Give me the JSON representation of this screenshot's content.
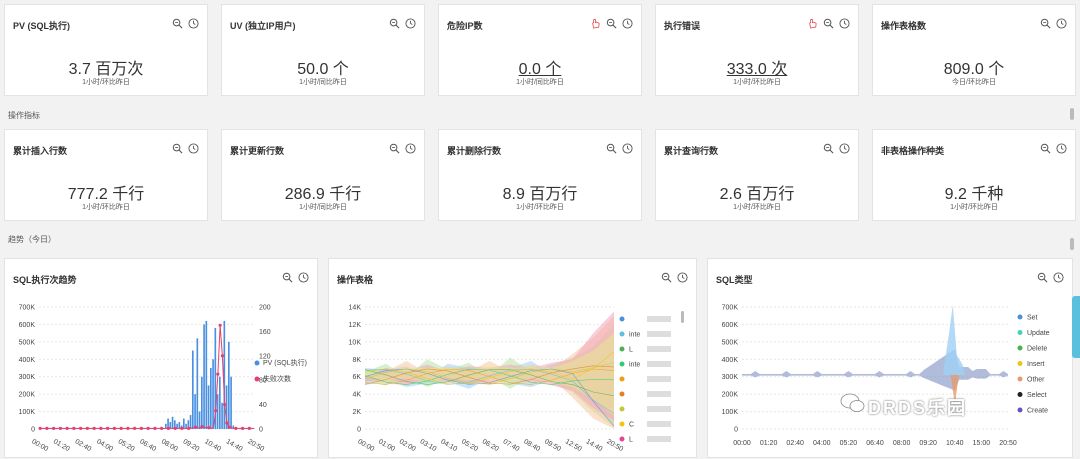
{
  "metrics_top": [
    {
      "title": "PV (SQL执行)",
      "value": "3.7 百万次",
      "sub": "1小时/环比昨日",
      "link": false,
      "alert": false
    },
    {
      "title": "UV (独立IP用户)",
      "value": "50.0 个",
      "sub": "1小时/同比昨日",
      "link": false,
      "alert": false
    },
    {
      "title": "危险IP数",
      "value": "0.0 个",
      "sub": "1小时/同比昨日",
      "link": true,
      "alert": true
    },
    {
      "title": "执行错误",
      "value": "333.0 次",
      "sub": "1小时/环比昨日",
      "link": true,
      "alert": true
    },
    {
      "title": "操作表格数",
      "value": "809.0 个",
      "sub": "今日/环比昨日",
      "link": false,
      "alert": false
    }
  ],
  "section_ops": "操作指标",
  "metrics_mid": [
    {
      "title": "累计插入行数",
      "value": "777.2 千行",
      "sub": "1小时/环比昨日"
    },
    {
      "title": "累计更新行数",
      "value": "286.9 千行",
      "sub": "1小时/同比昨日"
    },
    {
      "title": "累计删除行数",
      "value": "8.9 百万行",
      "sub": "1小时/环比昨日"
    },
    {
      "title": "累计查询行数",
      "value": "2.6 百万行",
      "sub": "1小时/环比昨日"
    },
    {
      "title": "非表格操作种类",
      "value": "9.2 千种",
      "sub": "1小时/环比昨日"
    }
  ],
  "section_trend": "趋势（今日）",
  "colors": {
    "pv": "#4a90e2",
    "err": "#e6416e",
    "blue_area": "#9fd0f5"
  },
  "watermark": "DRDS乐园",
  "chart_data": [
    {
      "type": "bar",
      "title": "SQL执行次趋势",
      "x": [
        "00:00",
        "01:20",
        "02:40",
        "04:00",
        "05:20",
        "06:40",
        "08:00",
        "09:20",
        "10:40",
        "14:40",
        "20:50"
      ],
      "ylim_left": [
        0,
        700000
      ],
      "ylim_right": [
        0,
        200
      ],
      "yticks_left": [
        "0",
        "100K",
        "200K",
        "300K",
        "400K",
        "500K",
        "600K",
        "700K"
      ],
      "yticks_right": [
        "0",
        "40",
        "80",
        "120",
        "160",
        "200"
      ],
      "series": [
        {
          "name": "PV (SQL执行)",
          "color": "#4a90e2"
        },
        {
          "name": "失败次数",
          "color": "#e6416e"
        }
      ],
      "pv_values": [
        5000,
        5000,
        5000,
        5000,
        5000,
        5000,
        5000,
        5000,
        5000,
        5000,
        5000,
        5000,
        5000,
        5000,
        5000,
        5000,
        5000,
        5000,
        5000,
        5000,
        5000,
        5000,
        5000,
        5000,
        5000,
        5000,
        5000,
        5000,
        5000,
        5000,
        5000,
        5000,
        5000,
        5000,
        5000,
        5000,
        5000,
        5000,
        5000,
        5000,
        5000,
        5000,
        5000,
        5000,
        5000,
        5000,
        5000,
        5000,
        5000,
        5000,
        5000,
        5000,
        5000,
        5000,
        5000,
        5000,
        30000,
        60000,
        40000,
        70000,
        50000,
        30000,
        40000,
        20000,
        60000,
        30000,
        50000,
        80000,
        450000,
        200000,
        520000,
        100000,
        300000,
        600000,
        620000,
        250000,
        350000,
        400000,
        580000,
        200000,
        300000,
        150000,
        620000,
        250000,
        500000,
        300000,
        20000,
        10000,
        5000,
        5000,
        5000,
        5000,
        5000,
        5000,
        5000,
        5000
      ],
      "err_values": [
        1,
        1,
        1,
        1,
        1,
        1,
        1,
        1,
        1,
        1,
        1,
        1,
        1,
        1,
        1,
        1,
        1,
        1,
        1,
        1,
        1,
        1,
        1,
        1,
        1,
        1,
        1,
        1,
        1,
        1,
        1,
        1,
        1,
        1,
        1,
        1,
        1,
        1,
        1,
        1,
        1,
        1,
        1,
        1,
        1,
        1,
        1,
        1,
        1,
        1,
        1,
        1,
        1,
        1,
        1,
        1,
        1,
        1,
        1,
        1,
        1,
        1,
        1,
        1,
        1,
        1,
        1,
        2,
        1,
        3,
        2,
        1,
        4,
        2,
        3,
        2,
        1,
        2,
        30,
        90,
        170,
        120,
        40,
        10,
        3,
        2,
        1,
        1,
        1,
        1,
        1,
        1,
        1,
        1,
        1,
        1
      ]
    },
    {
      "type": "area",
      "title": "操作表格",
      "x": [
        "00:00",
        "01:00",
        "02:00",
        "03:10",
        "04:10",
        "05:20",
        "06:20",
        "07:40",
        "08:40",
        "09:50",
        "12:50",
        "14:40",
        "20:50"
      ],
      "ylim": [
        0,
        14000
      ],
      "yticks": [
        "0",
        "2K",
        "4K",
        "6K",
        "8K",
        "10K",
        "12K",
        "14K"
      ],
      "legend": [
        {
          "name": "",
          "color": "#4a90e2"
        },
        {
          "name": "inte",
          "color": "#5bc0de"
        },
        {
          "name": "L",
          "color": "#4caf50"
        },
        {
          "name": "inte",
          "color": "#2ecc71"
        },
        {
          "name": "",
          "color": "#f39c12"
        },
        {
          "name": "",
          "color": "#e67e22"
        },
        {
          "name": "",
          "color": "#c0ca33"
        },
        {
          "name": "C",
          "color": "#f1c40f"
        },
        {
          "name": "L",
          "color": "#e84393"
        }
      ]
    },
    {
      "type": "area",
      "title": "SQL类型",
      "x": [
        "00:00",
        "01:20",
        "02:40",
        "04:00",
        "05:20",
        "06:40",
        "08:00",
        "09:20",
        "10:40",
        "15:00",
        "20:50"
      ],
      "ylim": [
        0,
        700000
      ],
      "yticks": [
        "0",
        "100K",
        "200K",
        "300K",
        "400K",
        "500K",
        "600K",
        "700K"
      ],
      "legend": [
        {
          "name": "Set",
          "color": "#4a90e2"
        },
        {
          "name": "Update",
          "color": "#48d1b6"
        },
        {
          "name": "Delete",
          "color": "#4caf50"
        },
        {
          "name": "Insert",
          "color": "#f1c40f"
        },
        {
          "name": "Other",
          "color": "#e89a6b"
        },
        {
          "name": "Select",
          "color": "#222222"
        },
        {
          "name": "Create",
          "color": "#6a4fc2"
        }
      ]
    }
  ]
}
